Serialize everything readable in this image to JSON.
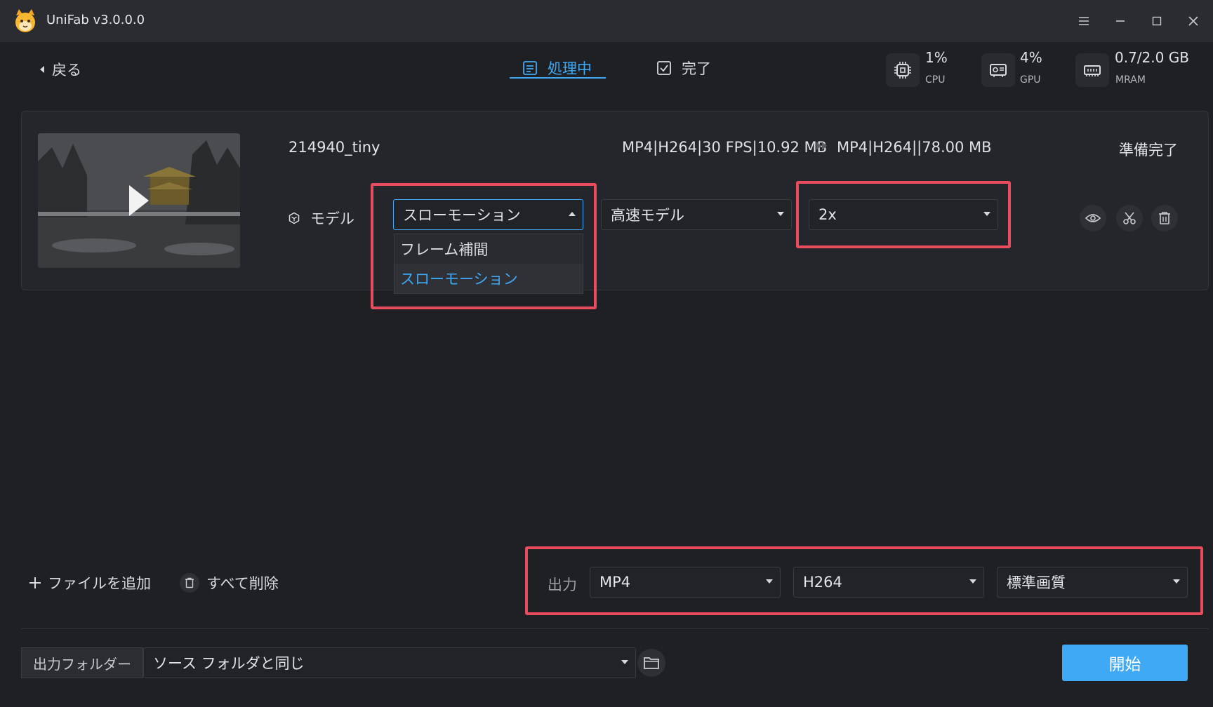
{
  "app": {
    "title": "UniFab v3.0.0.0"
  },
  "header": {
    "back_label": "戻る",
    "tabs": [
      {
        "label": "処理中",
        "active": true
      },
      {
        "label": "完了",
        "active": false
      }
    ],
    "stats": [
      {
        "value": "1%",
        "label": "CPU",
        "icon": "cpu-icon"
      },
      {
        "value": "4%",
        "label": "GPU",
        "icon": "gpu-icon"
      },
      {
        "value": "0.7/2.0 GB",
        "label": "MRAM",
        "icon": "memory-icon"
      }
    ]
  },
  "file": {
    "name": "214940_tiny",
    "source_info": "MP4|H264|30 FPS|10.92 MB",
    "output_info": "MP4|H264||78.00 MB",
    "status": "準備完了",
    "model_label": "モデル",
    "model_value": "スローモーション",
    "model_options": [
      "フレーム補間",
      "スローモーション"
    ],
    "speed_value": "高速モデル",
    "rate_value": "2x"
  },
  "toolbar": {
    "add_file": "ファイルを追加",
    "delete_all": "すべて削除",
    "output_label": "出力",
    "format": "MP4",
    "codec": "H264",
    "quality": "標準画質"
  },
  "footer": {
    "folder_label": "出力フォルダー",
    "folder_value": "ソース フォルダと同じ",
    "start": "開始"
  },
  "colors": {
    "accent": "#3fa9f5",
    "highlight": "#e84c5d",
    "background": "#1f2024"
  }
}
